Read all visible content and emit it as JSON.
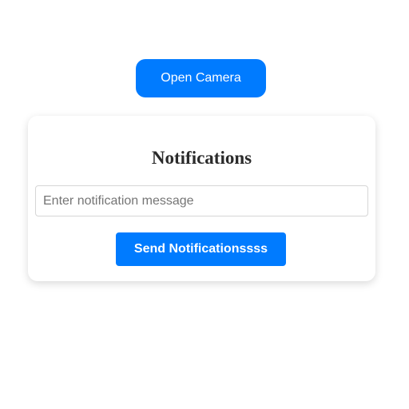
{
  "camera": {
    "open_label": "Open Camera"
  },
  "notifications": {
    "title": "Notifications",
    "message_placeholder": "Enter notification message",
    "message_value": "",
    "send_label": "Send Notificationssss"
  },
  "colors": {
    "primary_button": "#007bff",
    "button_text": "#ffffff",
    "card_background": "#ffffff",
    "page_background": "#ffffff"
  }
}
